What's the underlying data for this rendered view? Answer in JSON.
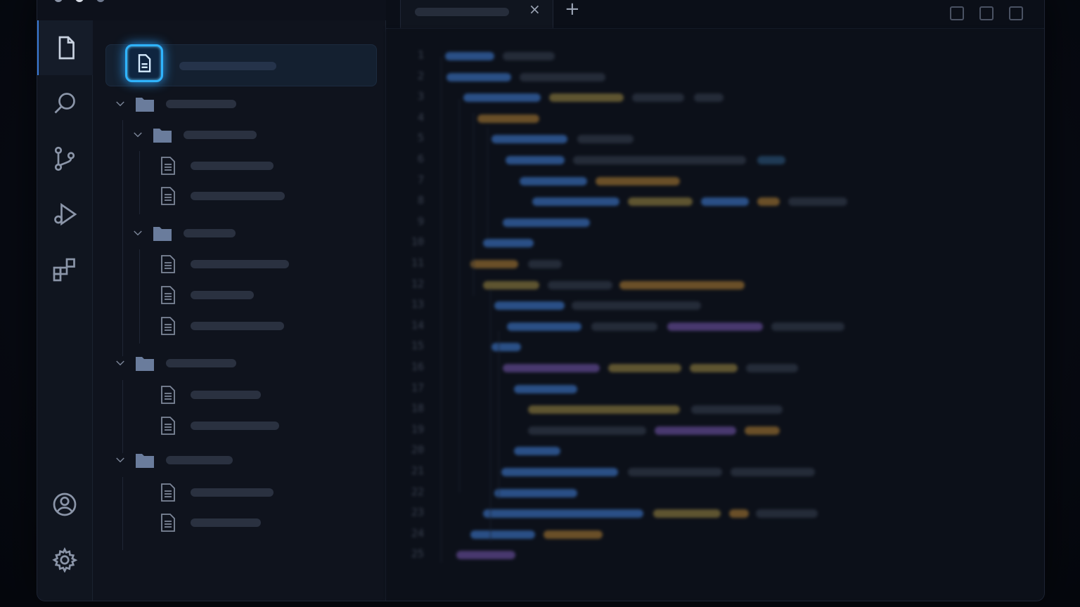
{
  "window": {
    "title": ""
  },
  "activity_bar": {
    "items": [
      {
        "name": "explorer",
        "icon": "file-icon",
        "active": true
      },
      {
        "name": "search",
        "icon": "search-icon",
        "active": false
      },
      {
        "name": "source-control",
        "icon": "git-branch-icon",
        "active": false
      },
      {
        "name": "run-debug",
        "icon": "run-debug-icon",
        "active": false
      },
      {
        "name": "extensions",
        "icon": "extensions-icon",
        "active": false
      }
    ],
    "bottom": [
      {
        "name": "account",
        "icon": "account-icon"
      },
      {
        "name": "settings",
        "icon": "gear-icon"
      }
    ]
  },
  "explorer": {
    "selected_file": {
      "label": "",
      "icon": "document-icon"
    },
    "tree": [
      {
        "type": "folder",
        "depth": 0,
        "label": "",
        "expanded": true
      },
      {
        "type": "folder",
        "depth": 1,
        "label": "",
        "expanded": true,
        "modified": true
      },
      {
        "type": "file",
        "depth": 2,
        "label": ""
      },
      {
        "type": "file",
        "depth": 2,
        "label": ""
      },
      {
        "type": "folder",
        "depth": 1,
        "label": "",
        "expanded": true
      },
      {
        "type": "file",
        "depth": 2,
        "label": ""
      },
      {
        "type": "file",
        "depth": 2,
        "label": ""
      },
      {
        "type": "file",
        "depth": 2,
        "label": ""
      },
      {
        "type": "folder",
        "depth": 0,
        "label": "",
        "expanded": true
      },
      {
        "type": "file",
        "depth": 2,
        "label": ""
      },
      {
        "type": "file",
        "depth": 2,
        "label": ""
      },
      {
        "type": "folder",
        "depth": 0,
        "label": "",
        "expanded": true
      },
      {
        "type": "file",
        "depth": 2,
        "label": ""
      },
      {
        "type": "file",
        "depth": 2,
        "label": ""
      }
    ]
  },
  "tabs": {
    "items": [
      {
        "label": "",
        "close": "×"
      }
    ],
    "add": "+"
  },
  "editor": {
    "line_numbers": [
      "1",
      "2",
      "3",
      "4",
      "5",
      "6",
      "7",
      "8",
      "9",
      "10",
      "11",
      "12",
      "13",
      "14",
      "15",
      "16",
      "17",
      "18",
      "19",
      "20",
      "21",
      "22",
      "23",
      "24",
      "25"
    ]
  },
  "colors": {
    "accent": "#2fb4ff",
    "keyword": "#2f5f9e",
    "string": "#7a6a3a",
    "function": "#5a4a8a",
    "comment": "#2a3140"
  }
}
